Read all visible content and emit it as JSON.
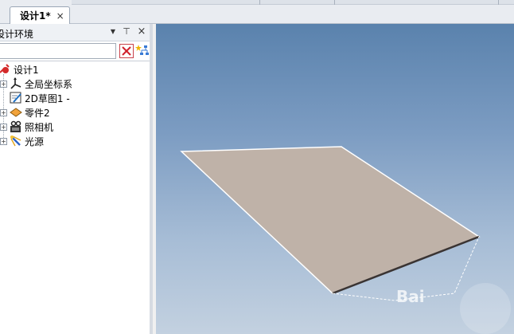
{
  "tab": {
    "label": "设计1*",
    "close": "×"
  },
  "panel": {
    "title": "设计环境",
    "dropdown": "▼",
    "pin": "⊤",
    "close": "×",
    "search_value": ""
  },
  "tree": {
    "root": {
      "label": "设计1"
    },
    "items": [
      {
        "label": "全局坐标系",
        "expander": "+"
      },
      {
        "label": "2D草图1 -",
        "expander": ""
      },
      {
        "label": "零件2",
        "expander": "+"
      },
      {
        "label": "照相机",
        "expander": "+"
      },
      {
        "label": "光源",
        "expander": "+"
      }
    ]
  },
  "viewport": {
    "watermark": "Bai",
    "plane_color": "#bfb2a8",
    "bg_top": "#5a82ad",
    "bg_bottom": "#c3d1e0"
  }
}
